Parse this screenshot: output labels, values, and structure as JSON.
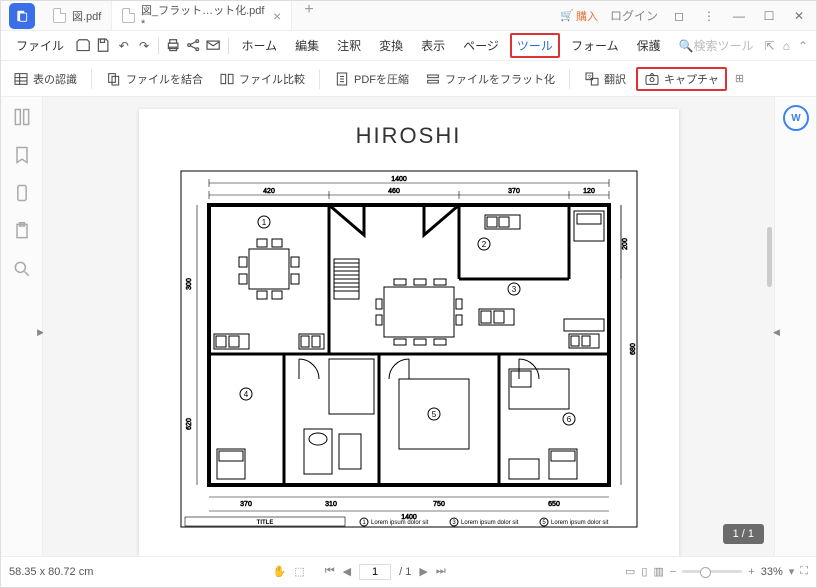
{
  "tabs": [
    {
      "label": "図.pdf",
      "active": false
    },
    {
      "label": "図_フラット…ット化.pdf *",
      "active": true
    }
  ],
  "titleRight": {
    "buy": "購入",
    "login": "ログイン"
  },
  "menu": {
    "file": "ファイル",
    "items": [
      "ホーム",
      "編集",
      "注釈",
      "変換",
      "表示",
      "ページ",
      "ツール",
      "フォーム",
      "保護"
    ],
    "active": "ツール",
    "search": "検索ツール"
  },
  "toolbar": {
    "tableRec": "表の認識",
    "combine": "ファイルを結合",
    "compare": "ファイル比較",
    "compress": "PDFを圧縮",
    "flatten": "ファイルをフラット化",
    "translate": "翻訳",
    "capture": "キャプチャ"
  },
  "document": {
    "title": "HIROSHI",
    "legendTitle": "TITLE",
    "legendText": "Lorem ipsum dolor sit",
    "dims": {
      "top": "1400",
      "l1": "420",
      "l2": "460",
      "l3": "370",
      "l4": "120",
      "h1": "300",
      "h2": "200",
      "h3": "680",
      "h4": "620",
      "b1": "370",
      "b2": "310",
      "b3": "750",
      "b4": "650"
    }
  },
  "pageIndicator": "1 / 1",
  "status": {
    "dims": "58.35 x 80.72 cm",
    "page": "1",
    "total": "1",
    "zoom": "33%"
  }
}
